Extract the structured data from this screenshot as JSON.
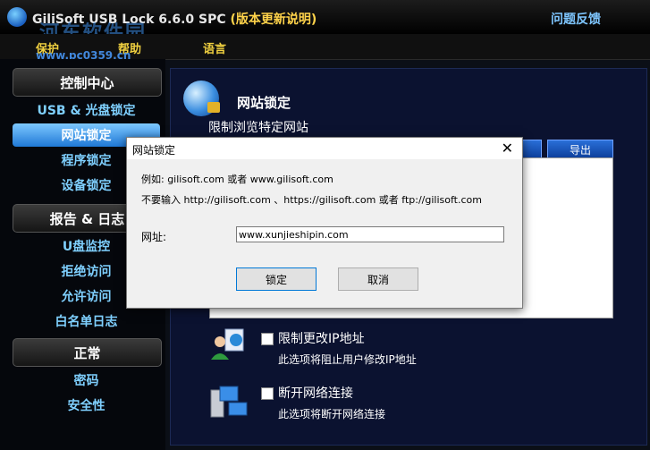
{
  "window": {
    "title": "GiliSoft USB Lock 6.6.0 SPC",
    "version_note": "(版本更新说明)",
    "feedback": "问题反馈",
    "watermark_cn": "河东软件园",
    "watermark_url": "www.pc0359.cn"
  },
  "menu": [
    "保护",
    "帮助",
    "语言"
  ],
  "sidebar": {
    "sections": [
      {
        "header": "控制中心",
        "items": [
          "USB & 光盘锁定",
          "网站锁定",
          "程序锁定",
          "设备锁定"
        ]
      },
      {
        "header": "报告 & 日志",
        "items": [
          "U盘监控",
          "拒绝访问",
          "允许访问",
          "白名单日志"
        ]
      },
      {
        "header": "正常",
        "items": [
          "密码",
          "安全性"
        ]
      }
    ],
    "active_item": "网站锁定"
  },
  "content": {
    "title": "网站锁定",
    "subtitle": "限制浏览特定网站",
    "export_button": "导出",
    "options": [
      {
        "label": "限制更改IP地址",
        "desc": "此选项将阻止用户修改IP地址",
        "checked": false
      },
      {
        "label": "断开网络连接",
        "desc": "此选项将断开网络连接",
        "checked": false
      }
    ]
  },
  "dialog": {
    "title": "网站锁定",
    "example": "例如: gilisoft.com 或者 www.gilisoft.com",
    "warning": "不要输入 http://gilisoft.com 、https://gilisoft.com 或者 ftp://gilisoft.com",
    "url_label": "网址:",
    "url_value": "www.xunjieshipin.com",
    "lock_button": "锁定",
    "cancel_button": "取消",
    "close_glyph": "✕"
  },
  "colors": {
    "accent": "#1f78d6",
    "menu_text": "#f0d040",
    "sidebar_text": "#7fd0ff",
    "version_note": "#ffd34a"
  }
}
